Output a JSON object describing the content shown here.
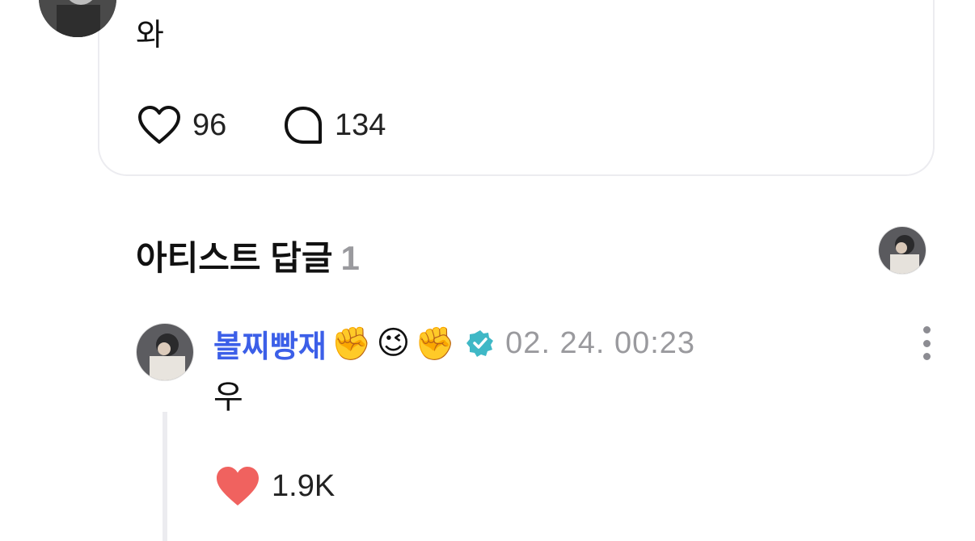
{
  "post": {
    "text": "와",
    "likes": "96",
    "comments": "134"
  },
  "section": {
    "title": "아티스트 답글",
    "count": "1"
  },
  "reply": {
    "author": "볼찌빵재",
    "emojis": [
      "✊",
      "😉",
      "✊"
    ],
    "timestamp": "02. 24. 00:23",
    "text": "우",
    "likes": "1.9K"
  },
  "colors": {
    "author": "#3c5fe8",
    "verified": "#3fb8c6",
    "like": "#f0625f",
    "muted": "#9a9a9e",
    "border": "#ececf0"
  },
  "icons": [
    "heart-outline-icon",
    "comment-bubble-icon",
    "verified-badge-icon",
    "more-vertical-icon",
    "heart-filled-icon"
  ]
}
